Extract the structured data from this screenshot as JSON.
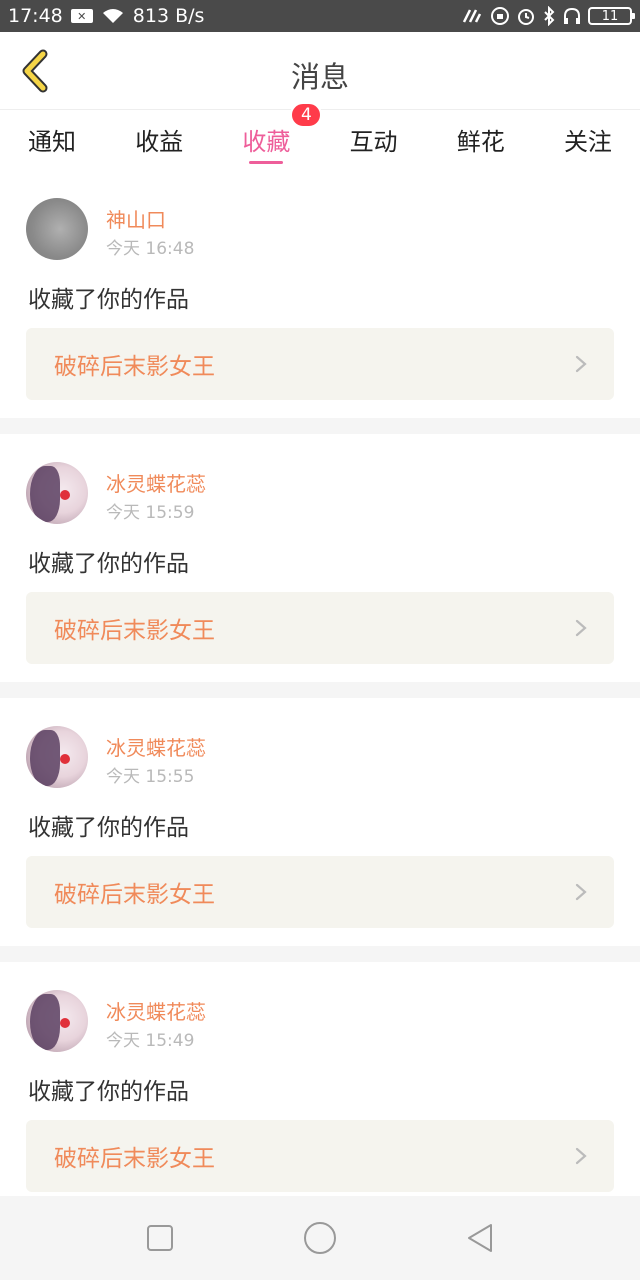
{
  "status_bar": {
    "time": "17:48",
    "network_speed": "813 B/s",
    "battery_level": "11",
    "icons": [
      "notification-x-icon",
      "wifi-icon",
      "nfc-icon",
      "rotation-lock-icon",
      "alarm-icon",
      "bluetooth-icon",
      "headphones-icon",
      "battery-icon"
    ]
  },
  "header": {
    "title": "消息",
    "back_icon": "chevron-left-icon"
  },
  "tabs": [
    {
      "label": "通知",
      "active": false
    },
    {
      "label": "收益",
      "active": false
    },
    {
      "label": "收藏",
      "active": true,
      "badge": "4"
    },
    {
      "label": "互动",
      "active": false
    },
    {
      "label": "鲜花",
      "active": false
    },
    {
      "label": "关注",
      "active": false
    }
  ],
  "notifications": [
    {
      "username": "神山口",
      "time": "今天 16:48",
      "action": "收藏了你的作品",
      "work": "破碎后末影女王",
      "avatar": "gray-avatar"
    },
    {
      "username": "冰灵蝶花蕊",
      "time": "今天 15:59",
      "action": "收藏了你的作品",
      "work": "破碎后末影女王",
      "avatar": "girl-avatar"
    },
    {
      "username": "冰灵蝶花蕊",
      "time": "今天 15:55",
      "action": "收藏了你的作品",
      "work": "破碎后末影女王",
      "avatar": "girl-avatar"
    },
    {
      "username": "冰灵蝶花蕊",
      "time": "今天 15:49",
      "action": "收藏了你的作品",
      "work": "破碎后末影女王",
      "avatar": "girl-avatar"
    }
  ],
  "colors": {
    "accent_pink": "#ee5e9a",
    "username_orange": "#f08a5a",
    "badge_red": "#ff3b4a",
    "back_yellow": "#f5d547",
    "work_box_bg": "#f5f4ee"
  },
  "nav_bar": {
    "icons": [
      "recent-apps-icon",
      "home-icon",
      "back-triangle-icon"
    ]
  }
}
